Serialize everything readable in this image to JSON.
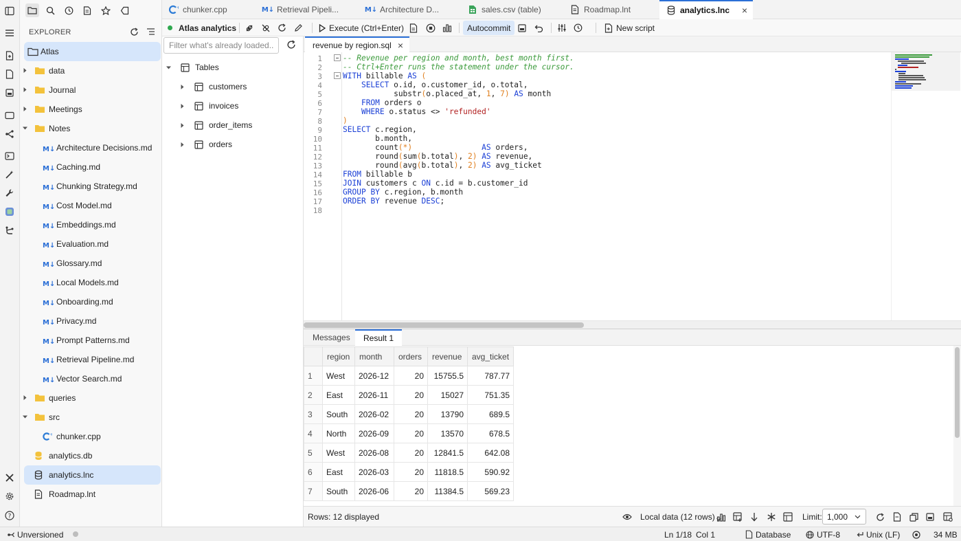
{
  "explorer": {
    "title": "EXPLORER",
    "root": "Atlas",
    "items": [
      {
        "label": "data",
        "type": "folder"
      },
      {
        "label": "Journal",
        "type": "folder"
      },
      {
        "label": "Meetings",
        "type": "folder"
      },
      {
        "label": "Notes",
        "type": "folder-open"
      },
      {
        "label": "Architecture Decisions.md",
        "type": "md"
      },
      {
        "label": "Caching.md",
        "type": "md"
      },
      {
        "label": "Chunking Strategy.md",
        "type": "md"
      },
      {
        "label": "Cost Model.md",
        "type": "md"
      },
      {
        "label": "Embeddings.md",
        "type": "md"
      },
      {
        "label": "Evaluation.md",
        "type": "md"
      },
      {
        "label": "Glossary.md",
        "type": "md"
      },
      {
        "label": "Local Models.md",
        "type": "md"
      },
      {
        "label": "Onboarding.md",
        "type": "md"
      },
      {
        "label": "Privacy.md",
        "type": "md"
      },
      {
        "label": "Prompt Patterns.md",
        "type": "md"
      },
      {
        "label": "Retrieval Pipeline.md",
        "type": "md"
      },
      {
        "label": "Vector Search.md",
        "type": "md"
      },
      {
        "label": "queries",
        "type": "folder"
      },
      {
        "label": "src",
        "type": "folder-open"
      },
      {
        "label": "chunker.cpp",
        "type": "cpp"
      },
      {
        "label": "analytics.db",
        "type": "db"
      },
      {
        "label": "analytics.lnc",
        "type": "lnc"
      },
      {
        "label": "Roadmap.lnt",
        "type": "lnt"
      }
    ]
  },
  "tabs": [
    {
      "label": "chunker.cpp"
    },
    {
      "label": "Retrieval Pipeli..."
    },
    {
      "label": "Architecture D..."
    },
    {
      "label": "sales.csv (table)"
    },
    {
      "label": "Roadmap.lnt"
    },
    {
      "label": "analytics.lnc",
      "close": "×"
    }
  ],
  "toolbar": {
    "connection": "Atlas analytics",
    "execute": "Execute (Ctrl+Enter)",
    "autocommit": "Autocommit",
    "new_script": "New script"
  },
  "navigator": {
    "filter_placeholder": "Filter what's already loaded...",
    "root": "Tables",
    "tables": [
      "customers",
      "invoices",
      "order_items",
      "orders"
    ]
  },
  "editor": {
    "tab": "revenue by region.sql",
    "tab_close": "×",
    "line_numbers": [
      "1",
      "2",
      "3",
      "4",
      "5",
      "6",
      "7",
      "8",
      "9",
      "10",
      "11",
      "12",
      "13",
      "14",
      "15",
      "16",
      "17",
      "18"
    ],
    "lines": [
      "-- Revenue per region and month, best month first.",
      "-- Ctrl+Enter runs the statement under the cursor.",
      "WITH billable AS (",
      "    SELECT o.id, o.customer_id, o.total,",
      "           substr(o.placed_at, 1, 7) AS month",
      "    FROM orders o",
      "    WHERE o.status <> 'refunded'",
      ")",
      "SELECT c.region,",
      "       b.month,",
      "       count(*)               AS orders,",
      "       round(sum(b.total), 2) AS revenue,",
      "       round(avg(b.total), 2) AS avg_ticket",
      "FROM billable b",
      "JOIN customers c ON c.id = b.customer_id",
      "GROUP BY c.region, b.month",
      "ORDER BY revenue DESC;",
      ""
    ]
  },
  "results": {
    "tabs": [
      "Messages",
      "Result 1"
    ],
    "columns": [
      "region",
      "month",
      "orders",
      "revenue",
      "avg_ticket"
    ],
    "rows": [
      {
        "n": "1",
        "region": "West",
        "month": "2026-12",
        "orders": "20",
        "revenue": "15755.5",
        "avg_ticket": "787.77"
      },
      {
        "n": "2",
        "region": "East",
        "month": "2026-11",
        "orders": "20",
        "revenue": "15027",
        "avg_ticket": "751.35"
      },
      {
        "n": "3",
        "region": "South",
        "month": "2026-02",
        "orders": "20",
        "revenue": "13790",
        "avg_ticket": "689.5"
      },
      {
        "n": "4",
        "region": "North",
        "month": "2026-09",
        "orders": "20",
        "revenue": "13570",
        "avg_ticket": "678.5"
      },
      {
        "n": "5",
        "region": "West",
        "month": "2026-08",
        "orders": "20",
        "revenue": "12841.5",
        "avg_ticket": "642.08"
      },
      {
        "n": "6",
        "region": "East",
        "month": "2026-03",
        "orders": "20",
        "revenue": "11818.5",
        "avg_ticket": "590.92"
      },
      {
        "n": "7",
        "region": "South",
        "month": "2026-06",
        "orders": "20",
        "revenue": "11384.5",
        "avg_ticket": "569.23"
      }
    ],
    "footer": {
      "rows_displayed": "Rows: 12 displayed",
      "source": "Local data (12 rows)",
      "limit_label": "Limit:",
      "limit_value": "1,000"
    }
  },
  "statusbar": {
    "vcs": "Unversioned",
    "position": "Ln 1/18",
    "col": "Col 1",
    "mode": "Database",
    "encoding": "UTF-8",
    "eol": "Unix (LF)",
    "memory": "34 MB"
  },
  "colors": {
    "accent": "#2b6fd6",
    "connection_status": "#2fa84f",
    "selection": "#d6e6fb"
  }
}
